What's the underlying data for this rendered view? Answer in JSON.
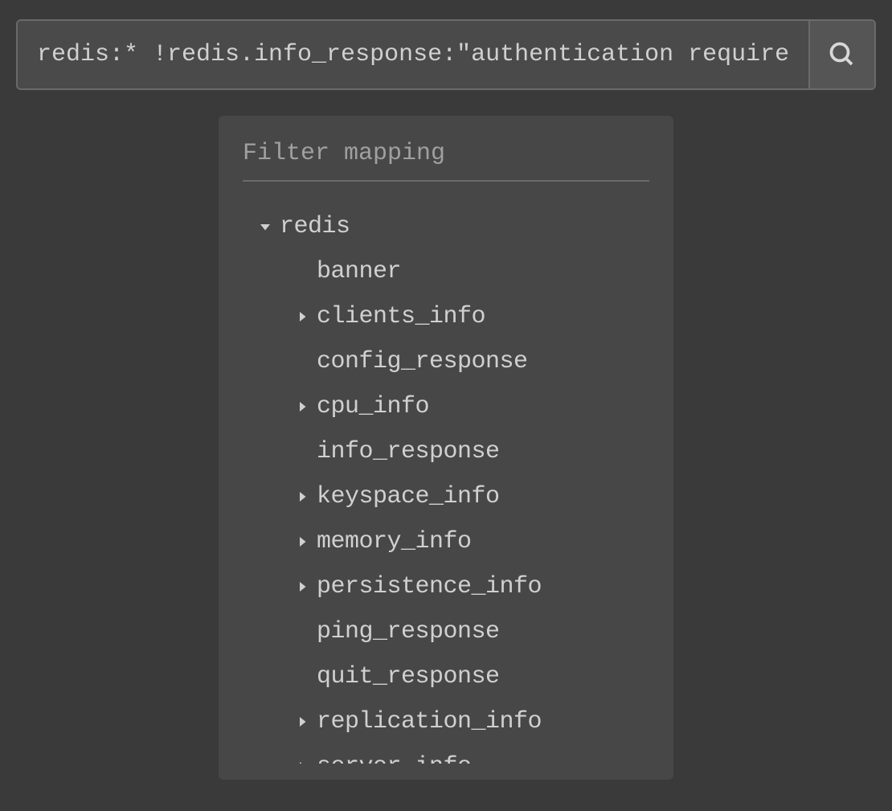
{
  "search": {
    "value": "redis:* !redis.info_response:\"authentication required\""
  },
  "filter": {
    "title": "Filter mapping",
    "root": {
      "label": "redis",
      "expanded": true,
      "children": [
        {
          "label": "banner",
          "expandable": false
        },
        {
          "label": "clients_info",
          "expandable": true
        },
        {
          "label": "config_response",
          "expandable": false
        },
        {
          "label": "cpu_info",
          "expandable": true
        },
        {
          "label": "info_response",
          "expandable": false
        },
        {
          "label": "keyspace_info",
          "expandable": true
        },
        {
          "label": "memory_info",
          "expandable": true
        },
        {
          "label": "persistence_info",
          "expandable": true
        },
        {
          "label": "ping_response",
          "expandable": false
        },
        {
          "label": "quit_response",
          "expandable": false
        },
        {
          "label": "replication_info",
          "expandable": true
        },
        {
          "label": "server_info",
          "expandable": true
        }
      ]
    }
  }
}
